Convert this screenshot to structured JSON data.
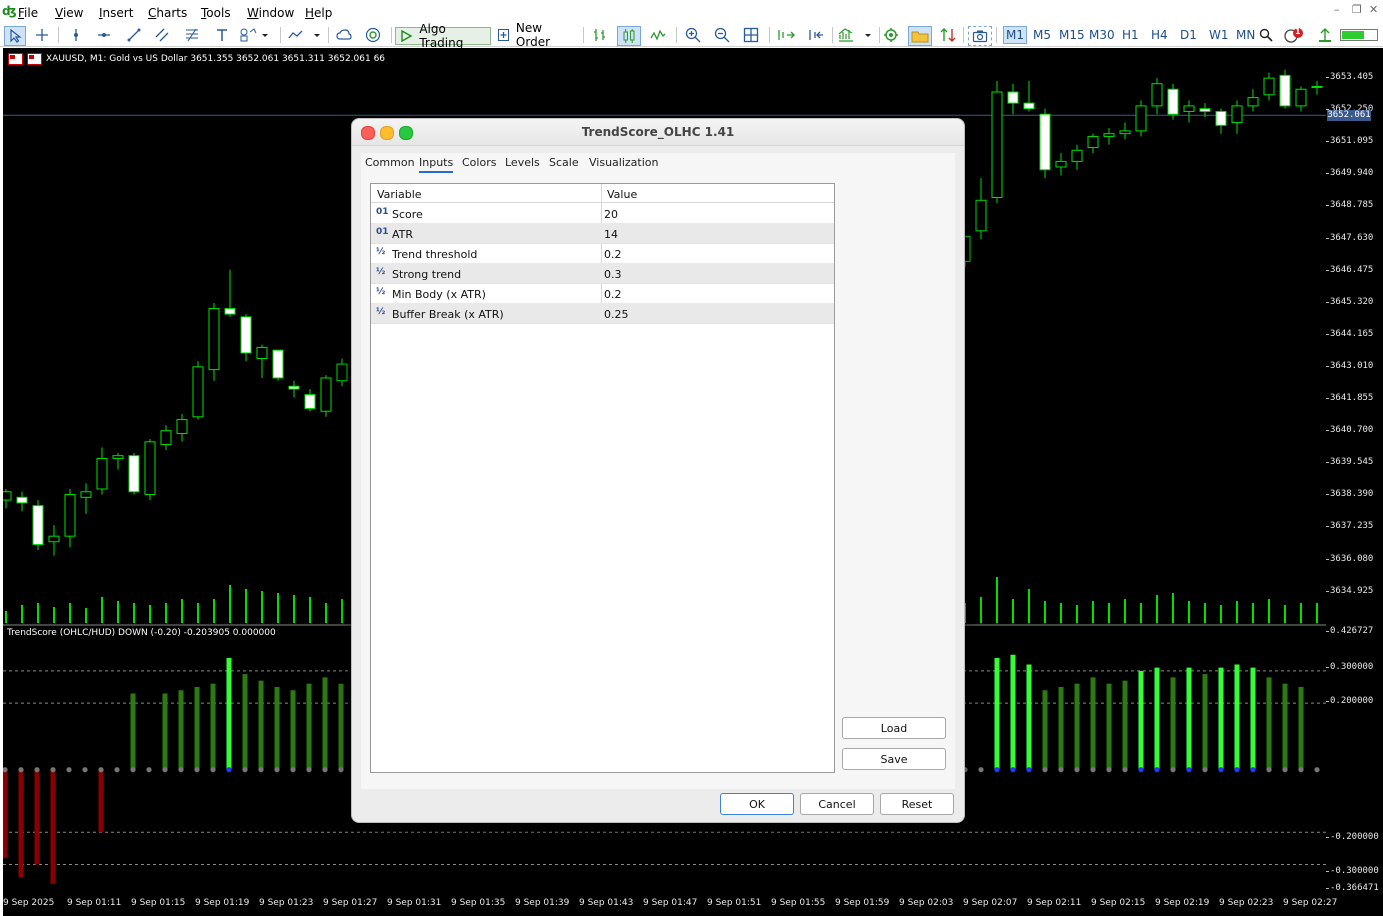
{
  "menu": [
    "File",
    "View",
    "Insert",
    "Charts",
    "Tools",
    "Window",
    "Help"
  ],
  "toolbar": {
    "algo_trading": "Algo Trading",
    "new_order": "New Order",
    "notification_count": "1"
  },
  "timeframes": [
    {
      "label": "M1",
      "active": true
    },
    {
      "label": "M5",
      "active": false
    },
    {
      "label": "M15",
      "active": false
    },
    {
      "label": "M30",
      "active": false
    },
    {
      "label": "H1",
      "active": false
    },
    {
      "label": "H4",
      "active": false
    },
    {
      "label": "D1",
      "active": false
    },
    {
      "label": "W1",
      "active": false
    },
    {
      "label": "MN",
      "active": false
    }
  ],
  "chart": {
    "symbol_header": "XAUUSD, M1:  Gold vs US Dollar  3651.355 3652.061 3651.311 3652.061  66",
    "indicator_label": "TrendScore (OHLC/HUD)  DOWN (-0.20) -0.203905 0.000000",
    "current_price": "3652.061",
    "price_ticks": [
      "3653.405",
      "3652.250",
      "3651.095",
      "3649.940",
      "3648.785",
      "3647.630",
      "3646.475",
      "3645.320",
      "3644.165",
      "3643.010",
      "3641.855",
      "3640.700",
      "3639.545",
      "3638.390",
      "3637.235",
      "3636.080",
      "3634.925"
    ],
    "indicator_ticks": [
      "0.426727",
      "0.300000",
      "0.200000",
      "-0.200000",
      "-0.300000",
      "-0.366471"
    ],
    "time_ticks": [
      "9 Sep 2025",
      "9 Sep 01:11",
      "9 Sep 01:15",
      "9 Sep 01:19",
      "9 Sep 01:23",
      "9 Sep 01:27",
      "9 Sep 01:31",
      "9 Sep 01:35",
      "9 Sep 01:39",
      "9 Sep 01:43",
      "9 Sep 01:47",
      "9 Sep 01:51",
      "9 Sep 01:55",
      "9 Sep 01:59",
      "9 Sep 02:03",
      "9 Sep 02:07",
      "9 Sep 02:11",
      "9 Sep 02:15",
      "9 Sep 02:19",
      "9 Sep 02:23",
      "9 Sep 02:27"
    ],
    "candles_visible": [
      {
        "o": 3638.2,
        "h": 3638.6,
        "l": 3637.9,
        "c": 3638.5
      },
      {
        "o": 3638.3,
        "h": 3638.5,
        "l": 3637.8,
        "c": 3638.1
      },
      {
        "o": 3638.0,
        "h": 3638.2,
        "l": 3636.4,
        "c": 3636.6
      },
      {
        "o": 3636.7,
        "h": 3637.3,
        "l": 3636.2,
        "c": 3636.9
      },
      {
        "o": 3636.9,
        "h": 3638.6,
        "l": 3636.5,
        "c": 3638.4
      },
      {
        "o": 3638.3,
        "h": 3638.8,
        "l": 3637.7,
        "c": 3638.5
      },
      {
        "o": 3638.6,
        "h": 3640.1,
        "l": 3638.4,
        "c": 3639.7
      },
      {
        "o": 3639.7,
        "h": 3639.9,
        "l": 3639.3,
        "c": 3639.8
      },
      {
        "o": 3639.8,
        "h": 3639.9,
        "l": 3638.4,
        "c": 3638.5
      },
      {
        "o": 3638.4,
        "h": 3640.4,
        "l": 3638.2,
        "c": 3640.3
      },
      {
        "o": 3640.2,
        "h": 3640.9,
        "l": 3640.0,
        "c": 3640.7
      },
      {
        "o": 3640.6,
        "h": 3641.3,
        "l": 3640.3,
        "c": 3641.1
      },
      {
        "o": 3641.2,
        "h": 3643.2,
        "l": 3641.1,
        "c": 3643.0
      },
      {
        "o": 3642.9,
        "h": 3645.3,
        "l": 3642.5,
        "c": 3645.1
      },
      {
        "o": 3645.1,
        "h": 3646.5,
        "l": 3644.8,
        "c": 3644.9
      },
      {
        "o": 3644.8,
        "h": 3644.9,
        "l": 3643.2,
        "c": 3643.5
      },
      {
        "o": 3643.3,
        "h": 3643.8,
        "l": 3642.6,
        "c": 3643.7
      },
      {
        "o": 3643.6,
        "h": 3643.6,
        "l": 3642.5,
        "c": 3642.6
      },
      {
        "o": 3642.3,
        "h": 3642.5,
        "l": 3641.9,
        "c": 3642.2
      },
      {
        "o": 3642.0,
        "h": 3642.2,
        "l": 3641.4,
        "c": 3641.5
      },
      {
        "o": 3641.4,
        "h": 3642.7,
        "l": 3641.2,
        "c": 3642.6
      },
      {
        "o": 3642.5,
        "h": 3643.3,
        "l": 3642.3,
        "c": 3643.1
      },
      {
        "o": 3643.2,
        "h": 3644.0,
        "l": 3643.0,
        "c": 3643.9
      }
    ],
    "candles_right": [
      {
        "o": 3646.8,
        "h": 3647.6,
        "l": 3646.6,
        "c": 3647.7
      },
      {
        "o": 3647.9,
        "h": 3649.8,
        "l": 3647.6,
        "c": 3649.0
      },
      {
        "o": 3649.1,
        "h": 3653.3,
        "l": 3648.9,
        "c": 3652.9
      },
      {
        "o": 3652.9,
        "h": 3653.2,
        "l": 3652.1,
        "c": 3652.5
      },
      {
        "o": 3652.5,
        "h": 3653.3,
        "l": 3652.2,
        "c": 3652.3
      },
      {
        "o": 3652.1,
        "h": 3652.3,
        "l": 3649.8,
        "c": 3650.1
      },
      {
        "o": 3650.2,
        "h": 3650.7,
        "l": 3649.9,
        "c": 3650.4
      },
      {
        "o": 3650.4,
        "h": 3651.0,
        "l": 3650.1,
        "c": 3650.8
      },
      {
        "o": 3650.9,
        "h": 3651.4,
        "l": 3650.7,
        "c": 3651.3
      },
      {
        "o": 3651.3,
        "h": 3651.6,
        "l": 3651.0,
        "c": 3651.4
      },
      {
        "o": 3651.4,
        "h": 3651.8,
        "l": 3651.2,
        "c": 3651.5
      },
      {
        "o": 3651.5,
        "h": 3652.6,
        "l": 3651.3,
        "c": 3652.4
      },
      {
        "o": 3652.4,
        "h": 3653.4,
        "l": 3652.1,
        "c": 3653.2
      },
      {
        "o": 3653.0,
        "h": 3653.2,
        "l": 3651.9,
        "c": 3652.1
      },
      {
        "o": 3652.2,
        "h": 3652.6,
        "l": 3651.8,
        "c": 3652.4
      },
      {
        "o": 3652.3,
        "h": 3652.5,
        "l": 3652.0,
        "c": 3652.2
      },
      {
        "o": 3652.2,
        "h": 3652.3,
        "l": 3651.4,
        "c": 3651.7
      },
      {
        "o": 3651.8,
        "h": 3652.6,
        "l": 3651.4,
        "c": 3652.4
      },
      {
        "o": 3652.4,
        "h": 3653.0,
        "l": 3652.2,
        "c": 3652.7
      },
      {
        "o": 3652.8,
        "h": 3653.6,
        "l": 3652.6,
        "c": 3653.4
      },
      {
        "o": 3653.5,
        "h": 3653.7,
        "l": 3652.3,
        "c": 3652.4
      },
      {
        "o": 3652.4,
        "h": 3653.1,
        "l": 3652.2,
        "c": 3653.0
      },
      {
        "o": 3653.1,
        "h": 3653.3,
        "l": 3652.8,
        "c": 3653.1
      },
      {
        "o": 3652.9,
        "h": 3653.9,
        "l": 3652.8,
        "c": 3653.6
      }
    ],
    "volumes_visible": [
      12,
      18,
      20,
      16,
      20,
      15,
      26,
      22,
      20,
      18,
      20,
      24,
      20,
      24,
      38,
      34,
      32,
      30,
      28,
      26,
      20,
      24,
      26
    ],
    "volumes_right": [
      20,
      26,
      46,
      24,
      34,
      22,
      20,
      18,
      22,
      20,
      24,
      20,
      28,
      30,
      22,
      20,
      18,
      22,
      20,
      24,
      18,
      20,
      20,
      18
    ],
    "scores_visible": [
      -0.28,
      -0.34,
      -0.3,
      -0.36,
      0,
      0,
      -0.2,
      0,
      0.23,
      0,
      0.23,
      0.24,
      0.25,
      0.26,
      0.34,
      0.29,
      0.27,
      0.25,
      0.24,
      0.26,
      0.28,
      0.26,
      0.29
    ],
    "scores_right": [
      0,
      0,
      0.34,
      0.35,
      0.32,
      0.24,
      0.25,
      0.26,
      0.28,
      0.26,
      0.27,
      0.3,
      0.31,
      0.28,
      0.31,
      0.29,
      0.31,
      0.32,
      0.31,
      0.28,
      0.26,
      0.25,
      0,
      0.24
    ]
  },
  "dialog": {
    "title": "TrendScore_OLHC 1.41",
    "tabs": [
      "Common",
      "Inputs",
      "Colors",
      "Levels",
      "Scale",
      "Visualization"
    ],
    "active_tab": "Inputs",
    "grid_headers": {
      "variable": "Variable",
      "value": "Value"
    },
    "inputs": [
      {
        "icon": "01",
        "name": "Score",
        "value": "20"
      },
      {
        "icon": "01",
        "name": "ATR",
        "value": "14"
      },
      {
        "icon": "½",
        "name": "Trend threshold",
        "value": "0.2"
      },
      {
        "icon": "½",
        "name": "Strong trend",
        "value": "0.3"
      },
      {
        "icon": "½",
        "name": "Min Body (x ATR)",
        "value": "0.2"
      },
      {
        "icon": "½",
        "name": "Buffer Break (x ATR)",
        "value": "0.25"
      }
    ],
    "buttons": {
      "load": "Load",
      "save": "Save",
      "ok": "OK",
      "cancel": "Cancel",
      "reset": "Reset"
    }
  },
  "colors": {
    "bull": "#00e000",
    "bear": "#ffffff",
    "score_strong": "#33ff33",
    "score_weak": "#2e7a12",
    "score_neg": "#8b0000",
    "grid_line": "#8a8a8a"
  }
}
